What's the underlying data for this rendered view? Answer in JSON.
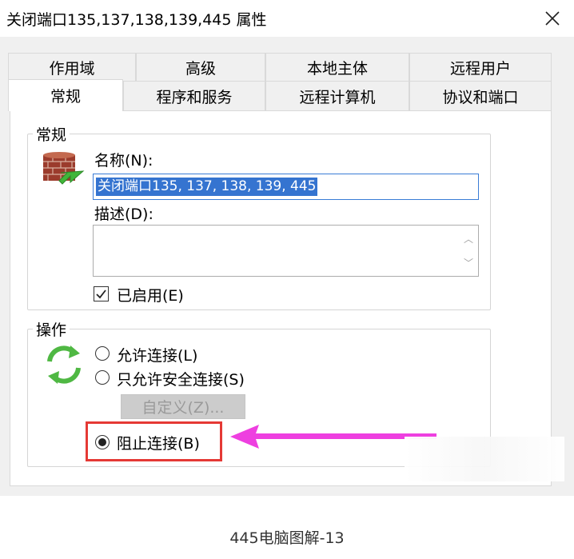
{
  "window": {
    "title": "关闭端口135,137,138,139,445 属性",
    "close_icon": "close-icon"
  },
  "tabs": {
    "row1": [
      "作用域",
      "高级",
      "本地主体",
      "远程用户"
    ],
    "row2": [
      "常规",
      "程序和服务",
      "远程计算机",
      "协议和端口"
    ],
    "active": "常规"
  },
  "general_group": {
    "legend": "常规",
    "name_label": "名称(N):",
    "name_value": "关闭端口135, 137, 138, 139, 445",
    "description_label": "描述(D):",
    "description_value": "",
    "enabled_label": "已启用(E)",
    "enabled": true,
    "icon": "firewall-rule-icon"
  },
  "action_group": {
    "legend": "操作",
    "icon": "refresh-arrows-icon",
    "options": [
      {
        "label": "允许连接(L)",
        "selected": false
      },
      {
        "label": "只允许安全连接(S)",
        "selected": false
      },
      {
        "label": "阻止连接(B)",
        "selected": true
      }
    ],
    "customize_label": "自定义(Z)..."
  },
  "annotation": {
    "highlight_color": "#e53935",
    "arrow_color": "#ee3fe0"
  },
  "caption": "445电脑图解-13",
  "colors": {
    "dialog_bg": "#f0f0f0",
    "selection": "#3574d0",
    "input_focus": "#3a7cd6"
  }
}
